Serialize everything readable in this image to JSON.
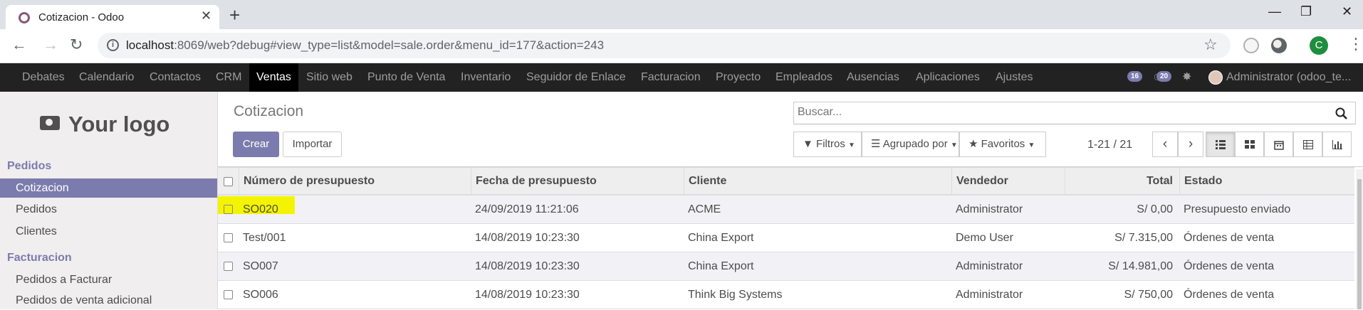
{
  "browser": {
    "tab_title": "Cotizacion - Odoo",
    "url_host": "localhost",
    "url_rest": ":8069/web?debug#view_type=list&model=sale.order&menu_id=177&action=243",
    "profile_initial": "C"
  },
  "menu": {
    "items": [
      "Debates",
      "Calendario",
      "Contactos",
      "CRM",
      "Ventas",
      "Sitio web",
      "Punto de Venta",
      "Inventario",
      "Seguidor de Enlace",
      "Facturacion",
      "Proyecto",
      "Empleados",
      "Ausencias",
      "Aplicaciones",
      "Ajustes"
    ],
    "active": "Ventas",
    "activity_count": "16",
    "message_count": "20",
    "user": "Administrator (odoo_te..."
  },
  "sidebar": {
    "logo_text": "Your logo",
    "sections": [
      {
        "title": "Pedidos",
        "items": [
          "Cotizacion",
          "Pedidos",
          "Clientes"
        ]
      },
      {
        "title": "Facturacion",
        "items": [
          "Pedidos a Facturar",
          "Pedidos de venta adicional"
        ]
      }
    ],
    "active_item": "Cotizacion"
  },
  "control_panel": {
    "title": "Cotizacion",
    "create_label": "Crear",
    "import_label": "Importar",
    "search_placeholder": "Buscar...",
    "filters_label": "Filtros",
    "group_label": "Agrupado por",
    "favorites_label": "Favoritos",
    "pager": "1-21 / 21"
  },
  "table": {
    "columns": [
      "Número de presupuesto",
      "Fecha de presupuesto",
      "Cliente",
      "Vendedor",
      "Total",
      "Estado"
    ],
    "rows": [
      {
        "number": "SO020",
        "date": "24/09/2019 11:21:06",
        "customer": "ACME",
        "salesperson": "Administrator",
        "total": "S/ 0,00",
        "state": "Presupuesto enviado"
      },
      {
        "number": "Test/001",
        "date": "14/08/2019 10:23:30",
        "customer": "China Export",
        "salesperson": "Demo User",
        "total": "S/ 7.315,00",
        "state": "Órdenes de venta"
      },
      {
        "number": "SO007",
        "date": "14/08/2019 10:23:30",
        "customer": "China Export",
        "salesperson": "Administrator",
        "total": "S/ 14.981,00",
        "state": "Órdenes de venta"
      },
      {
        "number": "SO006",
        "date": "14/08/2019 10:23:30",
        "customer": "Think Big Systems",
        "salesperson": "Administrator",
        "total": "S/ 750,00",
        "state": "Órdenes de venta"
      }
    ]
  },
  "colors": {
    "odoo_purple": "#7c7bad",
    "nav_bg": "#222222",
    "highlight": "#f4f400"
  }
}
